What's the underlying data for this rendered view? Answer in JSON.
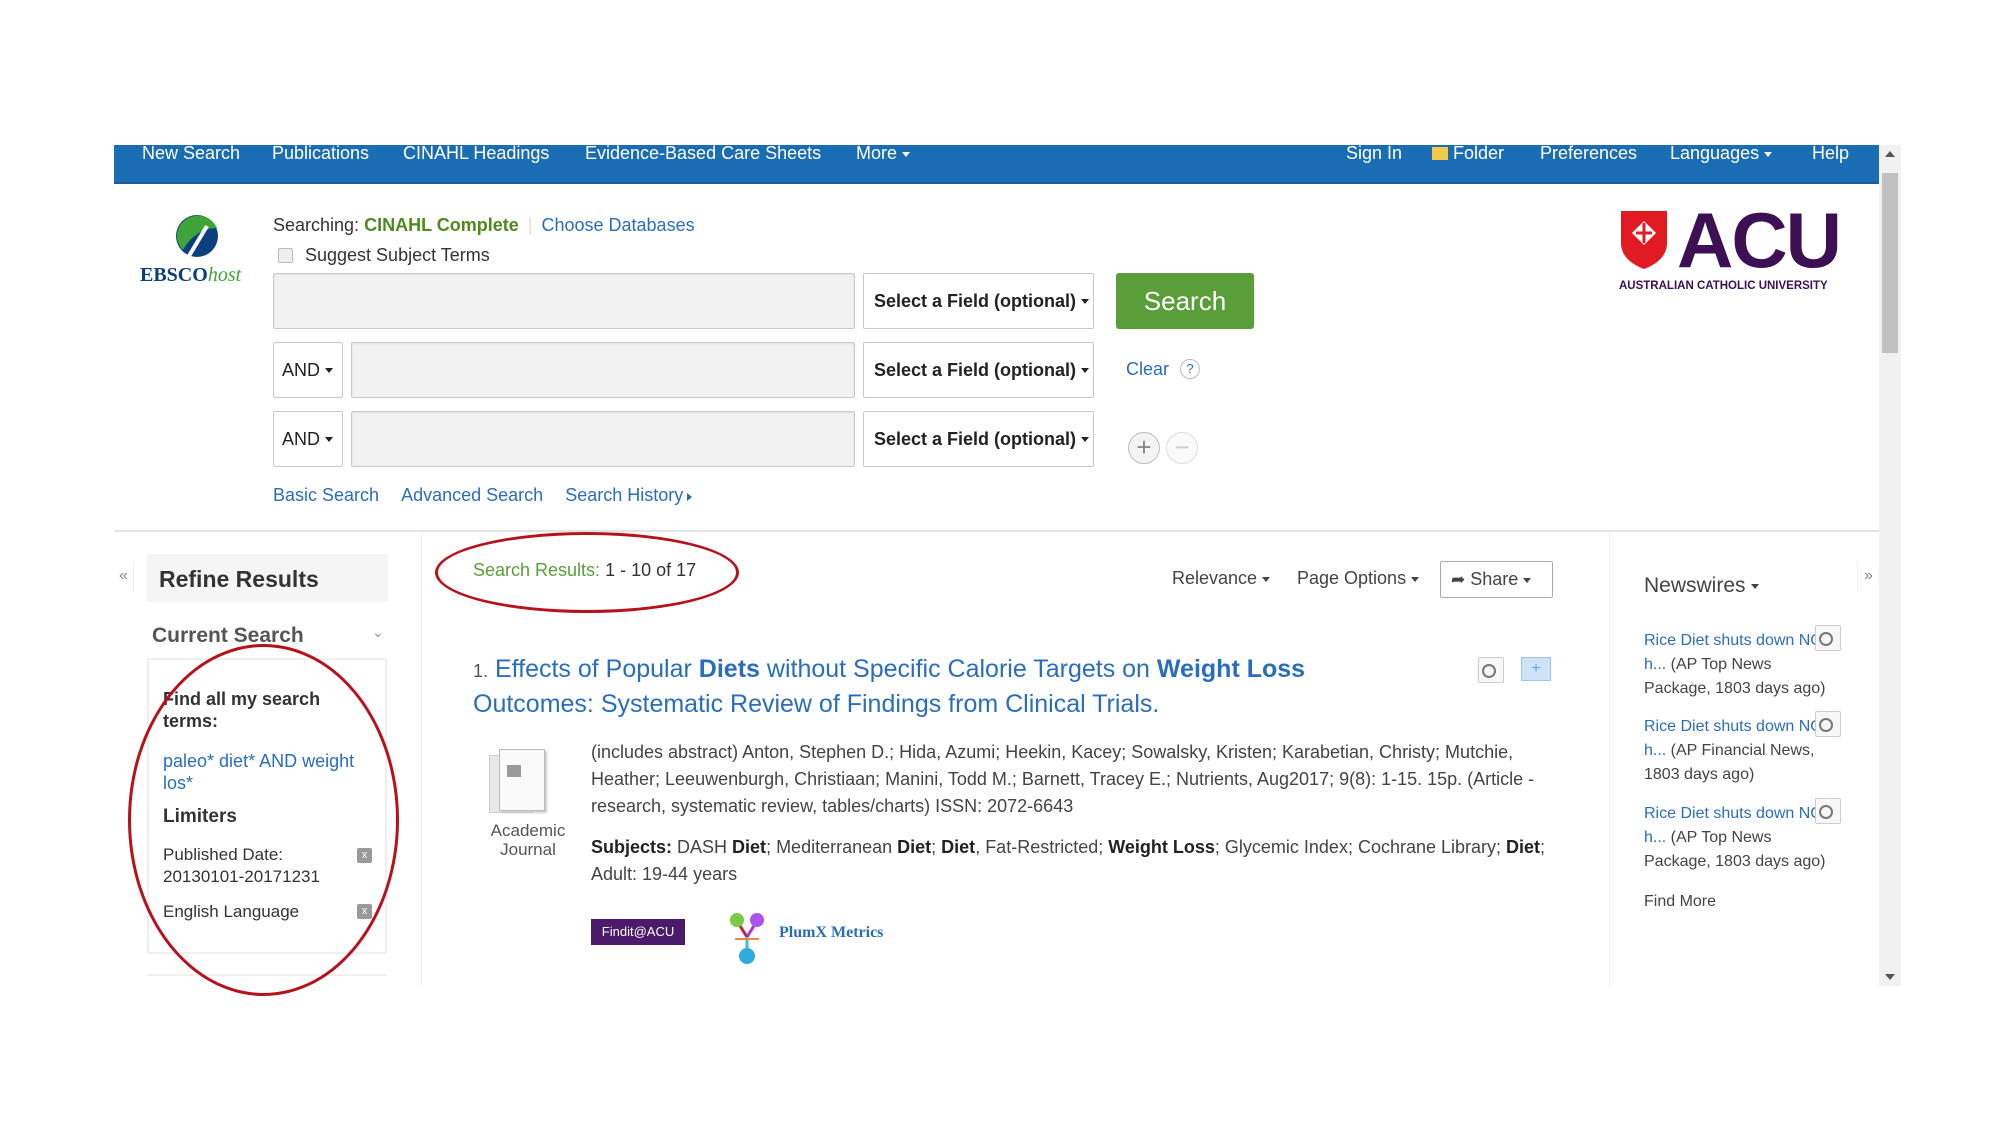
{
  "nav": {
    "left": [
      "New Search",
      "Publications",
      "CINAHL Headings",
      "Evidence-Based Care Sheets",
      "More"
    ],
    "right": [
      "Sign In",
      "Folder",
      "Preferences",
      "Languages",
      "Help"
    ]
  },
  "logo": {
    "ebsco": "EBSCO",
    "host": "host",
    "acu": "ACU",
    "acu_sub": "AUSTRALIAN CATHOLIC UNIVERSITY"
  },
  "search": {
    "searching_label": "Searching:",
    "database": "CINAHL Complete",
    "choose_databases": "Choose Databases",
    "suggest_terms": "Suggest Subject Terms",
    "field_placeholder": "Select a Field (optional)",
    "operators": [
      "AND",
      "AND"
    ],
    "search_button": "Search",
    "clear": "Clear",
    "help": "?",
    "links": [
      "Basic Search",
      "Advanced Search",
      "Search History"
    ]
  },
  "refine": {
    "title": "Refine Results",
    "current_search": "Current Search",
    "find_all": "Find all my search terms:",
    "query": "paleo* diet* AND weight los*",
    "limiters_label": "Limiters",
    "limiters": [
      {
        "label": "Published Date: 20130101-20171231"
      },
      {
        "label": "English Language"
      }
    ],
    "remove": "x"
  },
  "results": {
    "label": "Search Results:",
    "range": "1 - 10 of 17",
    "sort": "Relevance",
    "page_options": "Page Options",
    "share": "Share",
    "items": [
      {
        "number": "1.",
        "title_parts": [
          {
            "t": "Effects of Popular ",
            "b": false
          },
          {
            "t": "Diets",
            "b": true
          },
          {
            "t": " without Specific Calorie Targets on ",
            "b": false
          },
          {
            "t": "Weight Loss",
            "b": true
          },
          {
            "t": " Outcomes: Systematic Review of Findings from Clinical Trials.",
            "b": false
          }
        ],
        "type_line1": "Academic",
        "type_line2": "Journal",
        "citation": "(includes abstract) Anton, Stephen D.; Hida, Azumi; Heekin, Kacey; Sowalsky, Kristen; Karabetian, Christy; Mutchie, Heather; Leeuwenburgh, Christiaan; Manini, Todd M.; Barnett, Tracey E.; Nutrients, Aug2017; 9(8): 1-15. 15p. (Article - research, systematic review, tables/charts) ISSN: 2072-6643",
        "subjects_label": "Subjects:",
        "subjects_parts": [
          {
            "t": " DASH ",
            "b": false
          },
          {
            "t": "Diet",
            "b": true
          },
          {
            "t": "; Mediterranean ",
            "b": false
          },
          {
            "t": "Diet",
            "b": true
          },
          {
            "t": "; ",
            "b": false
          },
          {
            "t": "Diet",
            "b": true
          },
          {
            "t": ", Fat-Restricted; ",
            "b": false
          },
          {
            "t": "Weight Loss",
            "b": true
          },
          {
            "t": "; Glycemic Index; Cochrane Library; ",
            "b": false
          },
          {
            "t": "Diet",
            "b": true
          },
          {
            "t": "; Adult: 19-44 years",
            "b": false
          }
        ],
        "findit": "Findit@ACU",
        "plumx": "PlumX Metrics"
      }
    ]
  },
  "newswires": {
    "title": "Newswires",
    "items": [
      {
        "link": "Rice Diet shuts down NC h...",
        "source": " (AP Top News Package, 1803 days ago)"
      },
      {
        "link": "Rice Diet shuts down NC h...",
        "source": " (AP Financial News, 1803 days ago)"
      },
      {
        "link": "Rice Diet shuts down NC h...",
        "source": " (AP Top News Package, 1803 days ago)"
      }
    ],
    "find_more": "Find More"
  },
  "colors": {
    "nav": "#1b6db3",
    "search_button": "#5a9e3a",
    "database": "#4e8a1e",
    "annotation": "#b5121b",
    "acu_purple": "#3c1053",
    "acu_red": "#e21b23"
  }
}
